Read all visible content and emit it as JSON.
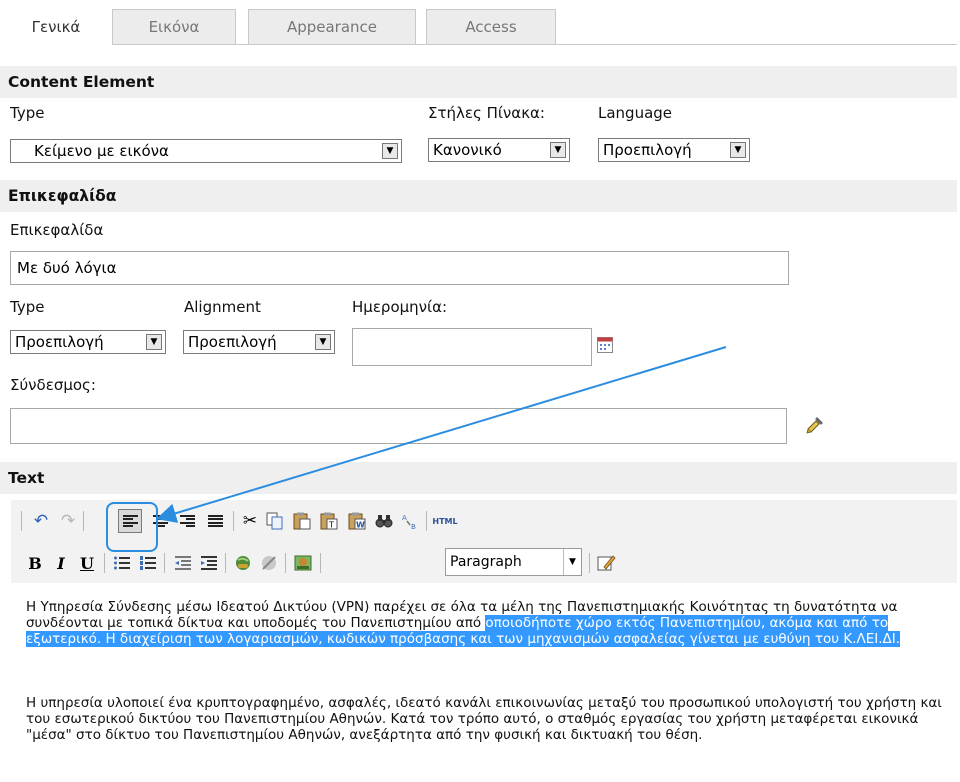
{
  "tabs": [
    {
      "label": "Γενικά",
      "active": true
    },
    {
      "label": "Εικόνα",
      "active": false
    },
    {
      "label": "Appearance",
      "active": false
    },
    {
      "label": "Access",
      "active": false
    }
  ],
  "content_element": {
    "section_title": "Content Element",
    "type_label": "Type",
    "type_value": "Κείμενο με εικόνα",
    "columns_label": "Στήλες Πίνακα:",
    "columns_value": "Κανονικό",
    "language_label": "Language",
    "language_value": "Προεπιλογή"
  },
  "header": {
    "section_title": "Επικεφαλίδα",
    "title_label": "Επικεφαλίδα",
    "title_value": "Με δυό λόγια",
    "type_label": "Type",
    "type_value": "Προεπιλογή",
    "alignment_label": "Alignment",
    "alignment_value": "Προεπιλογή",
    "date_label": "Ημερομηνία:",
    "date_value": "",
    "link_label": "Σύνδεσμος:",
    "link_value": ""
  },
  "text": {
    "section_title": "Text",
    "format_value": "Paragraph",
    "html_label": "HTML",
    "p1_normal": "Η Υπηρεσία Σύνδεσης μέσω Ιδεατού Δικτύου (VPN) παρέχει σε όλα τα μέλη της Πανεπιστημιακής Κοινότητας τη δυνατότητα να συνδέονται με τοπικά δίκτυα και υποδομές του Πανεπιστημίου από",
    "p1_selected": "οποιοδήποτε χώρο εκτός Πανεπιστημίου, ακόμα και από το εξωτερικό. Η διαχείριση των λογαριασμών, κωδικών πρόσβασης και των μηχανισμών ασφαλείας γίνεται με ευθύνη του Κ.ΛΕΙ.ΔΙ.",
    "p2": "Η υπηρεσία υλοποιεί ένα κρυπτογραφημένο, ασφαλές, ιδεατό κανάλι επικοινωνίας μεταξύ του προσωπικού υπολογιστή του χρήστη και του εσωτερικού δικτύου του Πανεπιστημίου Αθηνών. Κατά τον τρόπο αυτό, ο σταθμός εργασίας του χρήστη μεταφέρεται εικονικά \"μέσα\" στο δίκτυο του Πανεπιστημίου Αθηνών, ανεξάρτητα από την φυσική και δικτυακή του θέση."
  },
  "colors": {
    "highlight": "#3399ff",
    "annotation_arrow": "#2b8de0",
    "section_bg": "#efefef"
  }
}
